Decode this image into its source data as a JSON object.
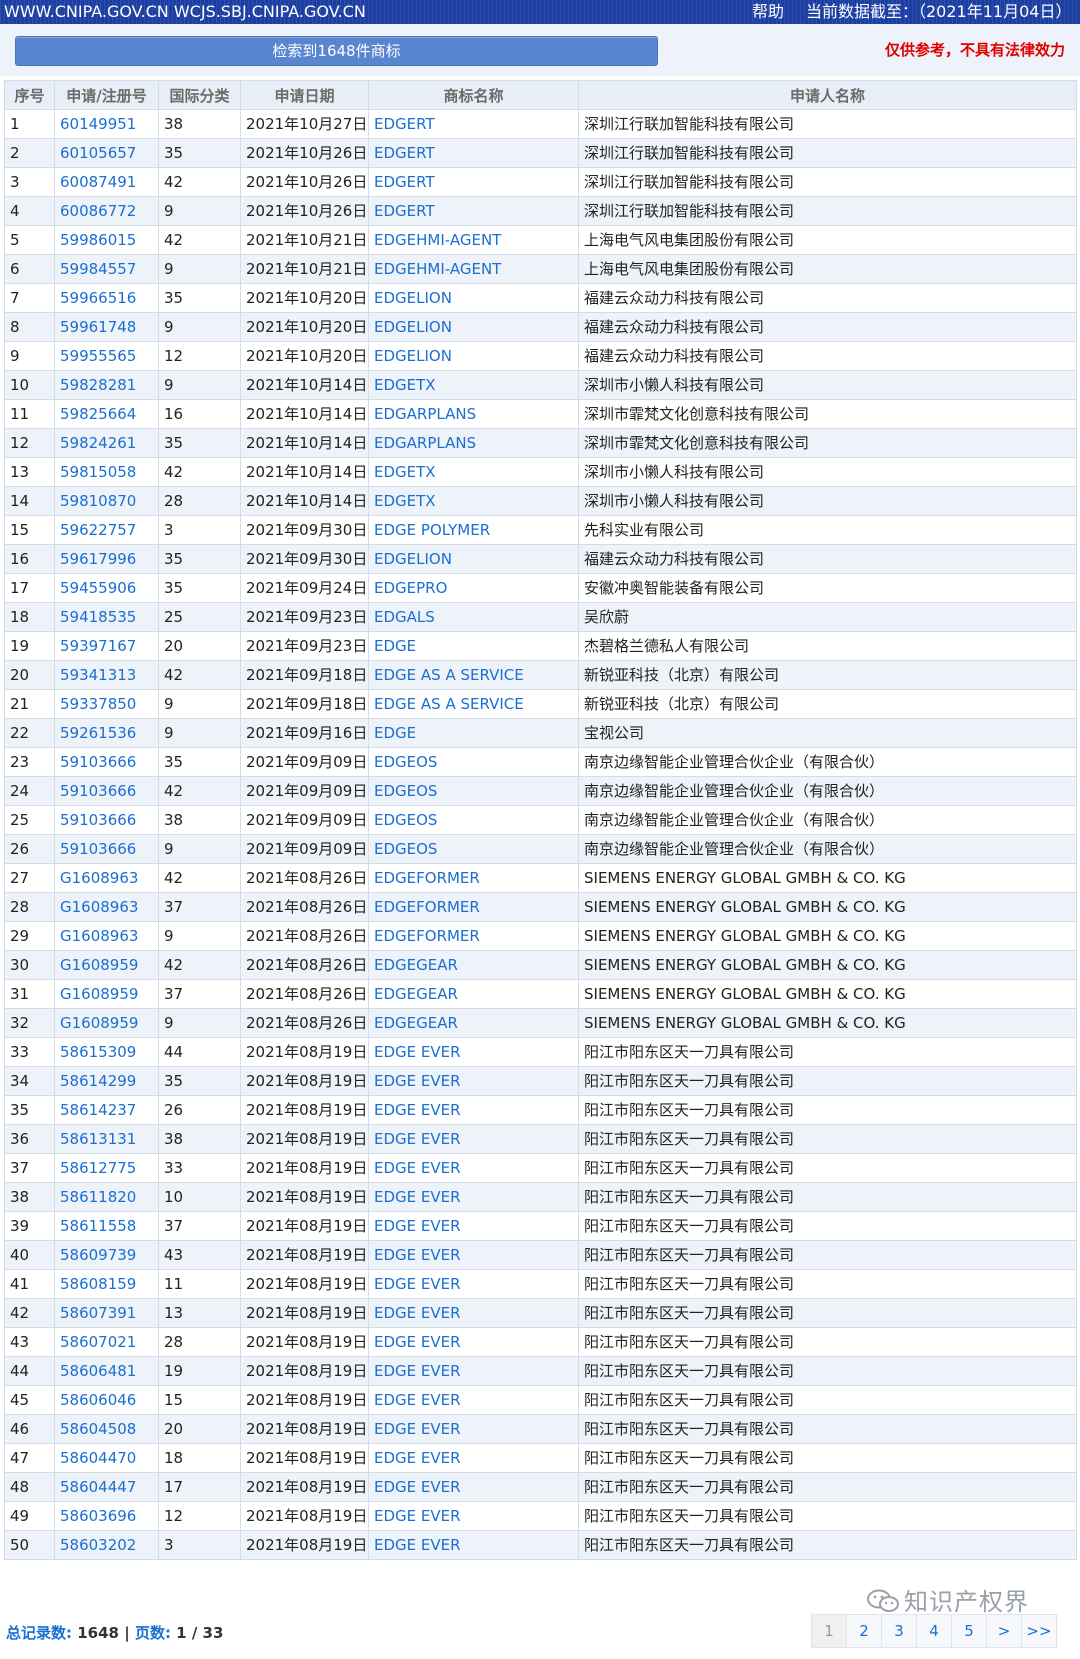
{
  "topbar": {
    "url": "WWW.CNIPA.GOV.CN WCJS.SBJ.CNIPA.GOV.CN",
    "help": "帮助",
    "cutoff": "当前数据截至：（2021年11月04日）"
  },
  "search": {
    "result_label": "检索到1648件商标",
    "disclaimer": "仅供参考，不具有法律效力"
  },
  "table": {
    "headers": [
      "序号",
      "申请/注册号",
      "国际分类",
      "申请日期",
      "商标名称",
      "申请人名称"
    ],
    "rows": [
      [
        "1",
        "60149951",
        "38",
        "2021年10月27日",
        "EDGERT",
        "深圳江行联加智能科技有限公司"
      ],
      [
        "2",
        "60105657",
        "35",
        "2021年10月26日",
        "EDGERT",
        "深圳江行联加智能科技有限公司"
      ],
      [
        "3",
        "60087491",
        "42",
        "2021年10月26日",
        "EDGERT",
        "深圳江行联加智能科技有限公司"
      ],
      [
        "4",
        "60086772",
        "9",
        "2021年10月26日",
        "EDGERT",
        "深圳江行联加智能科技有限公司"
      ],
      [
        "5",
        "59986015",
        "42",
        "2021年10月21日",
        "EDGEHMI-AGENT",
        "上海电气风电集团股份有限公司"
      ],
      [
        "6",
        "59984557",
        "9",
        "2021年10月21日",
        "EDGEHMI-AGENT",
        "上海电气风电集团股份有限公司"
      ],
      [
        "7",
        "59966516",
        "35",
        "2021年10月20日",
        "EDGELION",
        "福建云众动力科技有限公司"
      ],
      [
        "8",
        "59961748",
        "9",
        "2021年10月20日",
        "EDGELION",
        "福建云众动力科技有限公司"
      ],
      [
        "9",
        "59955565",
        "12",
        "2021年10月20日",
        "EDGELION",
        "福建云众动力科技有限公司"
      ],
      [
        "10",
        "59828281",
        "9",
        "2021年10月14日",
        "EDGETX",
        "深圳市小懒人科技有限公司"
      ],
      [
        "11",
        "59825664",
        "16",
        "2021年10月14日",
        "EDGARPLANS",
        "深圳市霏梵文化创意科技有限公司"
      ],
      [
        "12",
        "59824261",
        "35",
        "2021年10月14日",
        "EDGARPLANS",
        "深圳市霏梵文化创意科技有限公司"
      ],
      [
        "13",
        "59815058",
        "42",
        "2021年10月14日",
        "EDGETX",
        "深圳市小懒人科技有限公司"
      ],
      [
        "14",
        "59810870",
        "28",
        "2021年10月14日",
        "EDGETX",
        "深圳市小懒人科技有限公司"
      ],
      [
        "15",
        "59622757",
        "3",
        "2021年09月30日",
        "EDGE POLYMER",
        "先科实业有限公司"
      ],
      [
        "16",
        "59617996",
        "35",
        "2021年09月30日",
        "EDGELION",
        "福建云众动力科技有限公司"
      ],
      [
        "17",
        "59455906",
        "35",
        "2021年09月24日",
        "EDGEPRO",
        "安徽冲奥智能装备有限公司"
      ],
      [
        "18",
        "59418535",
        "25",
        "2021年09月23日",
        "EDGALS",
        "吴欣蔚"
      ],
      [
        "19",
        "59397167",
        "20",
        "2021年09月23日",
        "EDGE",
        "杰碧格兰德私人有限公司"
      ],
      [
        "20",
        "59341313",
        "42",
        "2021年09月18日",
        "EDGE AS A SERVICE",
        "新锐亚科技（北京）有限公司"
      ],
      [
        "21",
        "59337850",
        "9",
        "2021年09月18日",
        "EDGE AS A SERVICE",
        "新锐亚科技（北京）有限公司"
      ],
      [
        "22",
        "59261536",
        "9",
        "2021年09月16日",
        "EDGE",
        "宝视公司"
      ],
      [
        "23",
        "59103666",
        "35",
        "2021年09月09日",
        "EDGEOS",
        "南京边缘智能企业管理合伙企业（有限合伙）"
      ],
      [
        "24",
        "59103666",
        "42",
        "2021年09月09日",
        "EDGEOS",
        "南京边缘智能企业管理合伙企业（有限合伙）"
      ],
      [
        "25",
        "59103666",
        "38",
        "2021年09月09日",
        "EDGEOS",
        "南京边缘智能企业管理合伙企业（有限合伙）"
      ],
      [
        "26",
        "59103666",
        "9",
        "2021年09月09日",
        "EDGEOS",
        "南京边缘智能企业管理合伙企业（有限合伙）"
      ],
      [
        "27",
        "G1608963",
        "42",
        "2021年08月26日",
        "EDGEFORMER",
        "SIEMENS ENERGY GLOBAL GMBH & CO. KG"
      ],
      [
        "28",
        "G1608963",
        "37",
        "2021年08月26日",
        "EDGEFORMER",
        "SIEMENS ENERGY GLOBAL GMBH & CO. KG"
      ],
      [
        "29",
        "G1608963",
        "9",
        "2021年08月26日",
        "EDGEFORMER",
        "SIEMENS ENERGY GLOBAL GMBH & CO. KG"
      ],
      [
        "30",
        "G1608959",
        "42",
        "2021年08月26日",
        "EDGEGEAR",
        "SIEMENS ENERGY GLOBAL GMBH & CO. KG"
      ],
      [
        "31",
        "G1608959",
        "37",
        "2021年08月26日",
        "EDGEGEAR",
        "SIEMENS ENERGY GLOBAL GMBH & CO. KG"
      ],
      [
        "32",
        "G1608959",
        "9",
        "2021年08月26日",
        "EDGEGEAR",
        "SIEMENS ENERGY GLOBAL GMBH & CO. KG"
      ],
      [
        "33",
        "58615309",
        "44",
        "2021年08月19日",
        "EDGE EVER",
        "阳江市阳东区天一刀具有限公司"
      ],
      [
        "34",
        "58614299",
        "35",
        "2021年08月19日",
        "EDGE EVER",
        "阳江市阳东区天一刀具有限公司"
      ],
      [
        "35",
        "58614237",
        "26",
        "2021年08月19日",
        "EDGE EVER",
        "阳江市阳东区天一刀具有限公司"
      ],
      [
        "36",
        "58613131",
        "38",
        "2021年08月19日",
        "EDGE EVER",
        "阳江市阳东区天一刀具有限公司"
      ],
      [
        "37",
        "58612775",
        "33",
        "2021年08月19日",
        "EDGE EVER",
        "阳江市阳东区天一刀具有限公司"
      ],
      [
        "38",
        "58611820",
        "10",
        "2021年08月19日",
        "EDGE EVER",
        "阳江市阳东区天一刀具有限公司"
      ],
      [
        "39",
        "58611558",
        "37",
        "2021年08月19日",
        "EDGE EVER",
        "阳江市阳东区天一刀具有限公司"
      ],
      [
        "40",
        "58609739",
        "43",
        "2021年08月19日",
        "EDGE EVER",
        "阳江市阳东区天一刀具有限公司"
      ],
      [
        "41",
        "58608159",
        "11",
        "2021年08月19日",
        "EDGE EVER",
        "阳江市阳东区天一刀具有限公司"
      ],
      [
        "42",
        "58607391",
        "13",
        "2021年08月19日",
        "EDGE EVER",
        "阳江市阳东区天一刀具有限公司"
      ],
      [
        "43",
        "58607021",
        "28",
        "2021年08月19日",
        "EDGE EVER",
        "阳江市阳东区天一刀具有限公司"
      ],
      [
        "44",
        "58606481",
        "19",
        "2021年08月19日",
        "EDGE EVER",
        "阳江市阳东区天一刀具有限公司"
      ],
      [
        "45",
        "58606046",
        "15",
        "2021年08月19日",
        "EDGE EVER",
        "阳江市阳东区天一刀具有限公司"
      ],
      [
        "46",
        "58604508",
        "20",
        "2021年08月19日",
        "EDGE EVER",
        "阳江市阳东区天一刀具有限公司"
      ],
      [
        "47",
        "58604470",
        "18",
        "2021年08月19日",
        "EDGE EVER",
        "阳江市阳东区天一刀具有限公司"
      ],
      [
        "48",
        "58604447",
        "17",
        "2021年08月19日",
        "EDGE EVER",
        "阳江市阳东区天一刀具有限公司"
      ],
      [
        "49",
        "58603696",
        "12",
        "2021年08月19日",
        "EDGE EVER",
        "阳江市阳东区天一刀具有限公司"
      ],
      [
        "50",
        "58603202",
        "3",
        "2021年08月19日",
        "EDGE EVER",
        "阳江市阳东区天一刀具有限公司"
      ]
    ]
  },
  "footer": {
    "total_label": "总记录数:",
    "total_value": "1648",
    "sep": "|",
    "page_label": "页数:",
    "page_value": "1 / 33"
  },
  "pager": {
    "items": [
      "1",
      "2",
      "3",
      "4",
      "5",
      ">",
      ">>"
    ],
    "current": "1"
  },
  "watermark": {
    "text": "知识产权界"
  },
  "colors": {
    "topbar": "#1d3fa3",
    "link": "#1a6fd1",
    "disclaimer": "#e00000",
    "row_alt": "#eef2f9"
  }
}
